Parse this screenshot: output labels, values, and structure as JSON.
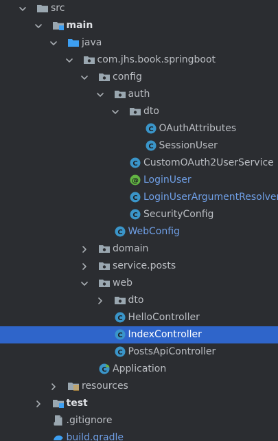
{
  "project_tree": {
    "nodes": [
      {
        "name": "src",
        "level": 0,
        "kind": "dir",
        "state": "expanded"
      },
      {
        "name": "main",
        "level": 1,
        "kind": "source-dir",
        "state": "expanded",
        "bold": true
      },
      {
        "name": "java",
        "level": 2,
        "kind": "java-root",
        "state": "expanded"
      },
      {
        "name": "com.jhs.book.springboot",
        "level": 3,
        "kind": "package",
        "state": "expanded"
      },
      {
        "name": "config",
        "level": 4,
        "kind": "package",
        "state": "expanded"
      },
      {
        "name": "auth",
        "level": 5,
        "kind": "package",
        "state": "expanded"
      },
      {
        "name": "dto",
        "level": 6,
        "kind": "package",
        "state": "expanded"
      },
      {
        "name": "OAuthAttributes",
        "level": 7,
        "kind": "class",
        "state": "leaf"
      },
      {
        "name": "SessionUser",
        "level": 7,
        "kind": "class",
        "state": "leaf"
      },
      {
        "name": "CustomOAuth2UserService",
        "level": 6,
        "kind": "class",
        "state": "leaf"
      },
      {
        "name": "LoginUser",
        "level": 6,
        "kind": "annotation",
        "state": "leaf",
        "modified": true
      },
      {
        "name": "LoginUserArgumentResolver",
        "level": 6,
        "kind": "class",
        "state": "leaf",
        "modified": true
      },
      {
        "name": "SecurityConfig",
        "level": 6,
        "kind": "class",
        "state": "leaf"
      },
      {
        "name": "WebConfig",
        "level": 5,
        "kind": "class",
        "state": "leaf",
        "modified": true
      },
      {
        "name": "domain",
        "level": 4,
        "kind": "package",
        "state": "collapsed"
      },
      {
        "name": "service.posts",
        "level": 4,
        "kind": "package",
        "state": "collapsed"
      },
      {
        "name": "web",
        "level": 4,
        "kind": "package",
        "state": "expanded"
      },
      {
        "name": "dto",
        "level": 5,
        "kind": "package",
        "state": "collapsed"
      },
      {
        "name": "HelloController",
        "level": 5,
        "kind": "class",
        "state": "leaf"
      },
      {
        "name": "IndexController",
        "level": 5,
        "kind": "class",
        "state": "leaf",
        "selected": true
      },
      {
        "name": "PostsApiController",
        "level": 5,
        "kind": "class",
        "state": "leaf"
      },
      {
        "name": "Application",
        "level": 4,
        "kind": "spring-class",
        "state": "leaf"
      },
      {
        "name": "resources",
        "level": 2,
        "kind": "resources",
        "state": "collapsed"
      },
      {
        "name": "test",
        "level": 1,
        "kind": "source-dir",
        "state": "collapsed",
        "bold": true
      },
      {
        "name": ".gitignore",
        "level": 1,
        "kind": "file",
        "state": "leaf"
      },
      {
        "name": "build.gradle",
        "level": 1,
        "kind": "gradle",
        "state": "leaf",
        "modified": true
      }
    ]
  },
  "colors": {
    "background": "#2b2d31",
    "text": "#bbbec3",
    "modified_text": "#6f9fe6",
    "selection": "#2f65ca",
    "folder_icon": "#9aa7b0",
    "source_dir_icon": "#3d9ff2",
    "class_icon": "#3a95c9",
    "annotation_icon": "#62b543",
    "spring_icon": "#6db33f"
  }
}
